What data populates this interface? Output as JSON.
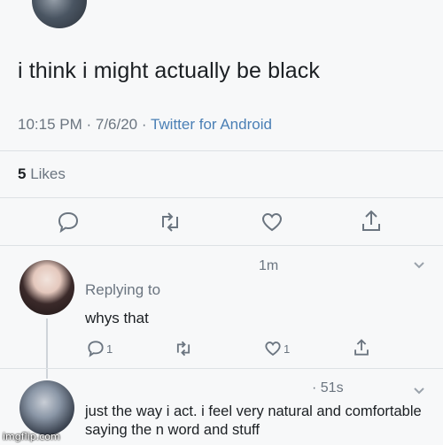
{
  "tweet": {
    "text": "i think i might actually be black",
    "timestamp": "10:15 PM · 7/6/20 · ",
    "client": "Twitter for Android",
    "likes_count": "5",
    "likes_label": "Likes"
  },
  "actions": {
    "reply_icon": "speech-bubble-icon",
    "retweet_icon": "retweet-icon",
    "like_icon": "heart-icon",
    "share_icon": "share-icon"
  },
  "replies": [
    {
      "time": "1m",
      "replying_to": "Replying to",
      "text": "whys that",
      "reply_count": "1",
      "like_count": "1"
    },
    {
      "time": "· 51s",
      "text": "just the way i act. i feel very natural and comfortable saying the n word and stuff"
    }
  ],
  "watermark": "imgflip.com",
  "colors": {
    "background": "#f7f8f9",
    "text": "#1b1f23",
    "secondary": "#6b7580",
    "link": "#4a7fb5"
  }
}
